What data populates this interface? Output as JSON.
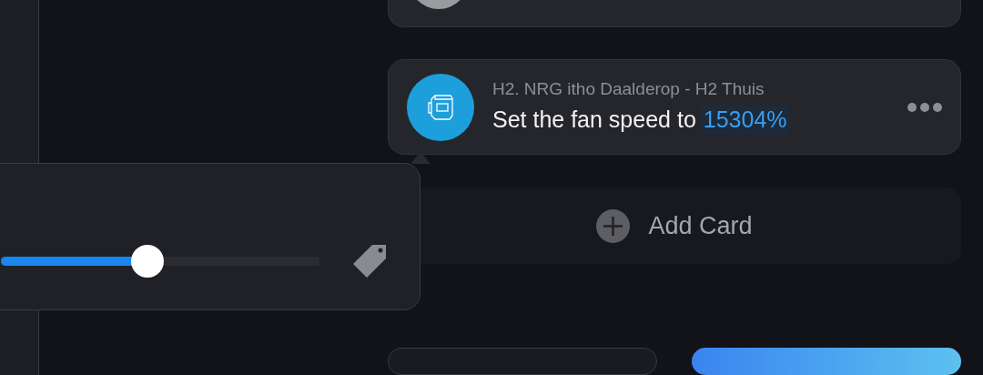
{
  "cards": [
    {
      "kind": "partial"
    },
    {
      "kind": "action",
      "subtitle": "H2. NRG itho Daalderop - H2 Thuis",
      "text": "Set the fan speed to",
      "value": "15304%"
    }
  ],
  "add_card": {
    "label": "Add Card"
  },
  "popover": {
    "slider": {
      "level": 0.46
    }
  },
  "bottom_buttons": [
    {
      "kind": "outline"
    },
    {
      "kind": "primary"
    }
  ]
}
